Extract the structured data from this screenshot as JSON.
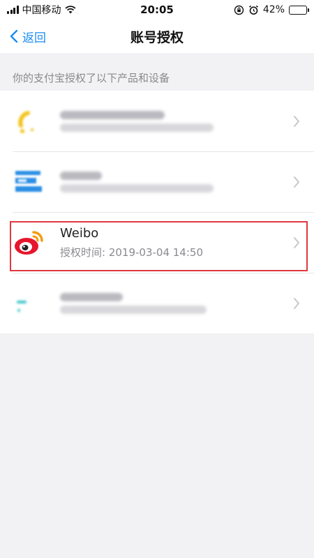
{
  "status_bar": {
    "carrier": "中国移动",
    "time": "20:05",
    "battery": "42%",
    "battery_level": 0.42
  },
  "nav": {
    "back_label": "返回",
    "title": "账号授权"
  },
  "section": {
    "header": "你的支付宝授权了以下产品和设备"
  },
  "list": {
    "items": [
      {
        "name": "",
        "time": ""
      },
      {
        "name": "",
        "time": ""
      },
      {
        "name": "Weibo",
        "time": "授权时间: 2019-03-04 14:50"
      },
      {
        "name": "",
        "time": ""
      }
    ]
  },
  "colors": {
    "accent": "#1a8cf0",
    "highlight": "#e0383e",
    "weibo_red": "#e6162d",
    "weibo_orange": "#f39c12"
  },
  "icons": [
    "signal-icon",
    "wifi-icon",
    "orientation-lock-icon",
    "alarm-icon",
    "battery-icon",
    "chevron-left-icon",
    "chevron-right-icon",
    "weibo-logo-icon"
  ]
}
